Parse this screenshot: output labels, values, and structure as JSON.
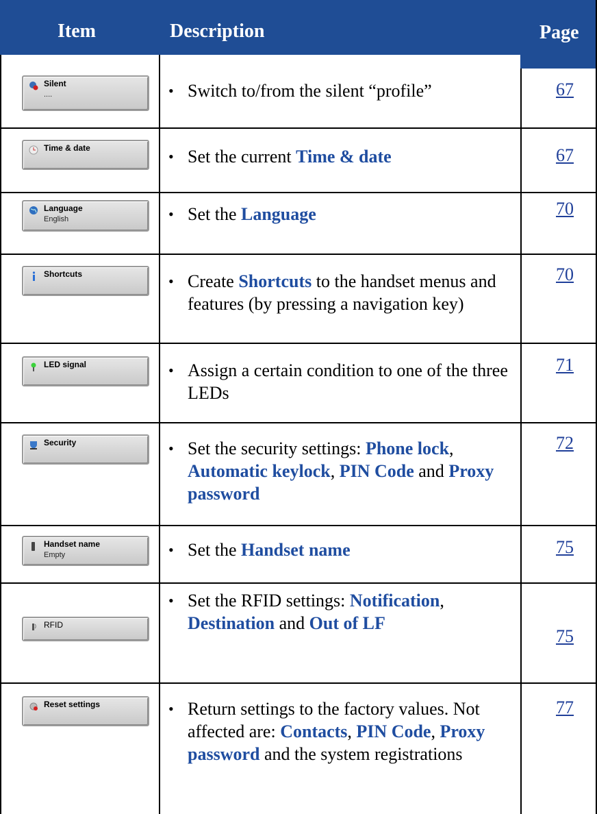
{
  "header": {
    "item": "Item",
    "description": "Description",
    "page": "Page"
  },
  "rows": [
    {
      "thumb_title": "Silent",
      "thumb_sub": "....",
      "icon": "silent-icon",
      "desc": [
        {
          "t": "Switch to/from the silent “profile”",
          "b": false
        }
      ],
      "page": "67"
    },
    {
      "thumb_title": "Time & date",
      "thumb_sub": "",
      "icon": "clock-icon",
      "desc": [
        {
          "t": "Set the current ",
          "b": false
        },
        {
          "t": "Time & date",
          "b": true
        }
      ],
      "page": "67"
    },
    {
      "thumb_title": "Language",
      "thumb_sub": "English",
      "icon": "globe-icon",
      "desc": [
        {
          "t": "Set the ",
          "b": false
        },
        {
          "t": "Language",
          "b": true
        }
      ],
      "page": "70"
    },
    {
      "thumb_title": "Shortcuts",
      "thumb_sub": "",
      "icon": "info-icon",
      "desc": [
        {
          "t": "Create ",
          "b": false
        },
        {
          "t": "Shortcuts",
          "b": true
        },
        {
          "t": " to the handset menus and features (by pressing a navigation key)",
          "b": false
        }
      ],
      "page": "70"
    },
    {
      "thumb_title": "LED signal",
      "thumb_sub": "",
      "icon": "led-icon",
      "desc": [
        {
          "t": "Assign a certain condition to one of the three LEDs",
          "b": false
        }
      ],
      "page": "71"
    },
    {
      "thumb_title": "Security",
      "thumb_sub": "",
      "icon": "shield-icon",
      "desc": [
        {
          "t": "Set the security settings: ",
          "b": false
        },
        {
          "t": "Phone lock",
          "b": true
        },
        {
          "t": ", ",
          "b": false
        },
        {
          "t": "Automatic keylock",
          "b": true
        },
        {
          "t": ", ",
          "b": false
        },
        {
          "t": "PIN Code",
          "b": true
        },
        {
          "t": " and ",
          "b": false
        },
        {
          "t": "Proxy password",
          "b": true
        }
      ],
      "page": "72"
    },
    {
      "thumb_title": "Handset name",
      "thumb_sub": "Empty",
      "icon": "handset-icon",
      "desc": [
        {
          "t": "Set the ",
          "b": false
        },
        {
          "t": "Handset name",
          "b": true
        }
      ],
      "page": "75"
    },
    {
      "thumb_title": "RFID",
      "thumb_sub": "",
      "icon": "rfid-icon",
      "desc": [
        {
          "t": "Set the RFID settings: ",
          "b": false
        },
        {
          "t": "Notification",
          "b": true
        },
        {
          "t": ", ",
          "b": false
        },
        {
          "t": "Destination",
          "b": true
        },
        {
          "t": " and ",
          "b": false
        },
        {
          "t": "Out of LF",
          "b": true
        }
      ],
      "page": "75"
    },
    {
      "thumb_title": "Reset settings",
      "thumb_sub": "",
      "icon": "reset-icon",
      "desc": [
        {
          "t": "Return settings to the factory values. Not affected are: ",
          "b": false
        },
        {
          "t": "Contacts",
          "b": true
        },
        {
          "t": ", ",
          "b": false
        },
        {
          "t": "PIN Code",
          "b": true
        },
        {
          "t": ", ",
          "b": false
        },
        {
          "t": "Proxy password",
          "b": true
        },
        {
          "t": " and the system registrations",
          "b": false
        }
      ],
      "page": "77"
    }
  ],
  "colors": {
    "header_bg": "#1f4d95",
    "bold_text": "#1f4da0",
    "link": "#1f3f99"
  }
}
